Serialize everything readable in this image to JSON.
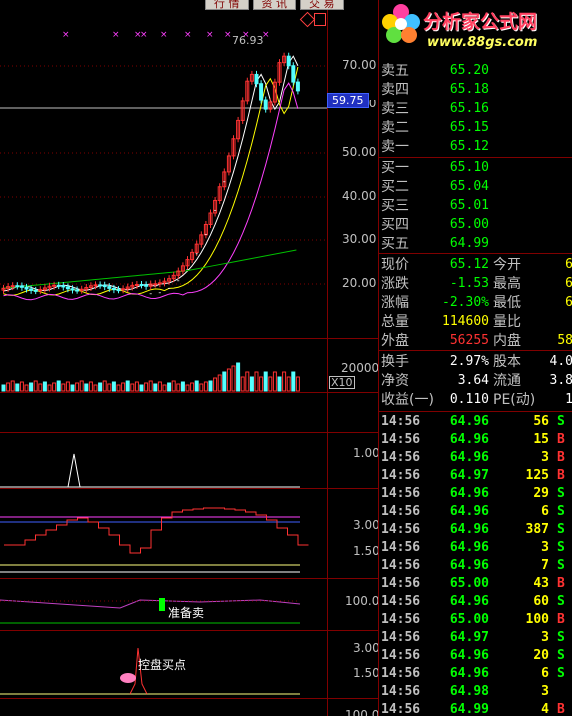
{
  "tabs": [
    "行 情",
    "资 讯",
    "交 易"
  ],
  "chart": {
    "price_axis": [
      "70.00",
      "50.00",
      "40.00",
      "30.00",
      "20.00"
    ],
    "partial_axis_label": "60.00",
    "high_label": "76.93",
    "current_price_marker": "59.75",
    "volume_axis": "20000",
    "volume_multiplier": "X10",
    "ind1_axis": "1.00",
    "ind2_axis": [
      "3.00",
      "1.50"
    ],
    "ind3_axis": "100.0",
    "ind3_label": "准备卖",
    "ind4_axis": [
      "3.00",
      "1.50"
    ],
    "ind4_label": "控盘买点",
    "bottom_axis_partial": "100.0"
  },
  "logo": {
    "title": "分析家公式网",
    "url": "www.88gs.com"
  },
  "asks": [
    {
      "label": "卖五",
      "price": "65.20"
    },
    {
      "label": "卖四",
      "price": "65.18"
    },
    {
      "label": "卖三",
      "price": "65.16"
    },
    {
      "label": "卖二",
      "price": "65.15"
    },
    {
      "label": "卖一",
      "price": "65.12"
    }
  ],
  "bids": [
    {
      "label": "买一",
      "price": "65.10"
    },
    {
      "label": "买二",
      "price": "65.04"
    },
    {
      "label": "买三",
      "price": "65.01"
    },
    {
      "label": "买四",
      "price": "65.00"
    },
    {
      "label": "买五",
      "price": "64.99"
    }
  ],
  "stats": [
    {
      "l1": "现价",
      "v1": "65.12",
      "c1": "g",
      "l2": "今开",
      "v2": "6"
    },
    {
      "l1": "涨跌",
      "v1": "-1.53",
      "c1": "g",
      "l2": "最高",
      "v2": "6"
    },
    {
      "l1": "涨幅",
      "v1": "-2.30%",
      "c1": "g",
      "l2": "最低",
      "v2": "6"
    },
    {
      "l1": "总量",
      "v1": "114600",
      "c1": "y",
      "l2": "量比",
      "v2": ""
    },
    {
      "l1": "外盘",
      "v1": "56255",
      "c1": "r",
      "l2": "内盘",
      "v2": "58"
    }
  ],
  "stats2": [
    {
      "l1": "换手",
      "v1": "2.97%",
      "l2": "股本",
      "v2": "4.0"
    },
    {
      "l1": "净资",
      "v1": "3.64",
      "l2": "流通",
      "v2": "3.8"
    },
    {
      "l1": "收益(一)",
      "v1": "0.110",
      "l2": "PE(动)",
      "v2": "1"
    }
  ],
  "ticks": [
    {
      "time": "14:56",
      "price": "64.96",
      "vol": "56",
      "vc": "y",
      "bs": "S",
      "bc": "g"
    },
    {
      "time": "14:56",
      "price": "64.96",
      "vol": "15",
      "vc": "y",
      "bs": "B",
      "bc": "r"
    },
    {
      "time": "14:56",
      "price": "64.96",
      "vol": "3",
      "vc": "y",
      "bs": "B",
      "bc": "r"
    },
    {
      "time": "14:56",
      "price": "64.97",
      "vol": "125",
      "vc": "y",
      "bs": "B",
      "bc": "r"
    },
    {
      "time": "14:56",
      "price": "64.96",
      "vol": "29",
      "vc": "y",
      "bs": "S",
      "bc": "g"
    },
    {
      "time": "14:56",
      "price": "64.96",
      "vol": "6",
      "vc": "y",
      "bs": "S",
      "bc": "g"
    },
    {
      "time": "14:56",
      "price": "64.96",
      "vol": "387",
      "vc": "y",
      "bs": "S",
      "bc": "g"
    },
    {
      "time": "14:56",
      "price": "64.96",
      "vol": "3",
      "vc": "y",
      "bs": "S",
      "bc": "g"
    },
    {
      "time": "14:56",
      "price": "64.96",
      "vol": "7",
      "vc": "y",
      "bs": "S",
      "bc": "g"
    },
    {
      "time": "14:56",
      "price": "65.00",
      "vol": "43",
      "vc": "y",
      "bs": "B",
      "bc": "r"
    },
    {
      "time": "14:56",
      "price": "64.96",
      "vol": "60",
      "vc": "y",
      "bs": "S",
      "bc": "g"
    },
    {
      "time": "14:56",
      "price": "65.00",
      "vol": "100",
      "vc": "y",
      "bs": "B",
      "bc": "r"
    },
    {
      "time": "14:56",
      "price": "64.97",
      "vol": "3",
      "vc": "y",
      "bs": "S",
      "bc": "g"
    },
    {
      "time": "14:56",
      "price": "64.96",
      "vol": "20",
      "vc": "y",
      "bs": "S",
      "bc": "g"
    },
    {
      "time": "14:56",
      "price": "64.96",
      "vol": "6",
      "vc": "y",
      "bs": "S",
      "bc": "g"
    },
    {
      "time": "14:56",
      "price": "64.98",
      "vol": "3",
      "vc": "y",
      "bs": "",
      "bc": "g"
    },
    {
      "time": "14:56",
      "price": "64.99",
      "vol": "4",
      "vc": "y",
      "bs": "B",
      "bc": "r"
    }
  ],
  "colors": {
    "up": "#ff3232",
    "down": "#54ffff",
    "ma_white": "#ffffff",
    "ma_yellow": "#ffff00",
    "ma_magenta": "#ff40ff",
    "ma_green": "#00c000",
    "grid": "#800000"
  }
}
